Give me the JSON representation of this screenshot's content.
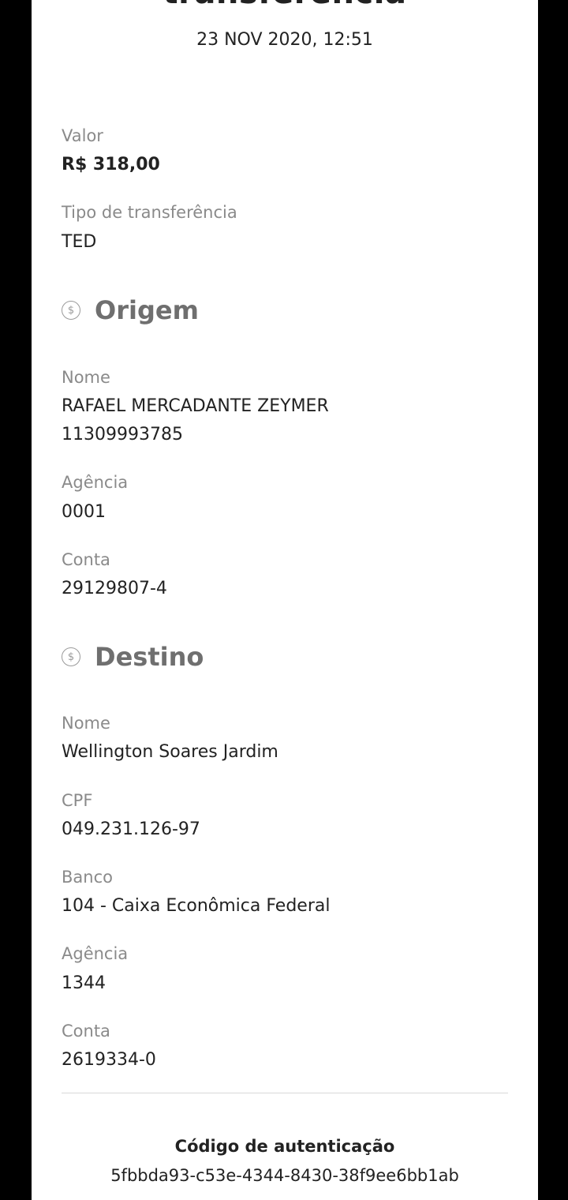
{
  "header": {
    "title": "transferência",
    "date": "23 NOV 2020, 12:51"
  },
  "summary": {
    "valor_label": "Valor",
    "valor": "R$ 318,00",
    "tipo_label": "Tipo de transferência",
    "tipo": "TED"
  },
  "origem": {
    "title": "Origem",
    "icon": "dollar-circle-icon",
    "nome_label": "Nome",
    "nome": "RAFAEL MERCADANTE ZEYMER",
    "documento": "11309993785",
    "agencia_label": "Agência",
    "agencia": "0001",
    "conta_label": "Conta",
    "conta": "29129807-4"
  },
  "destino": {
    "title": "Destino",
    "icon": "dollar-circle-icon",
    "nome_label": "Nome",
    "nome": "Wellington Soares Jardim",
    "cpf_label": "CPF",
    "cpf": "049.231.126-97",
    "banco_label": "Banco",
    "banco": "104 - Caixa Econômica Federal",
    "agencia_label": "Agência",
    "agencia": "1344",
    "conta_label": "Conta",
    "conta": "2619334-0"
  },
  "auth": {
    "label": "Código de autenticação",
    "code": "5fbbda93-c53e-4344-8430-38f9ee6bb1ab"
  },
  "colors": {
    "background": "#000000",
    "card": "#ffffff",
    "label": "#8a8a8a",
    "text": "#222222",
    "section_title": "#6f6f6f"
  }
}
